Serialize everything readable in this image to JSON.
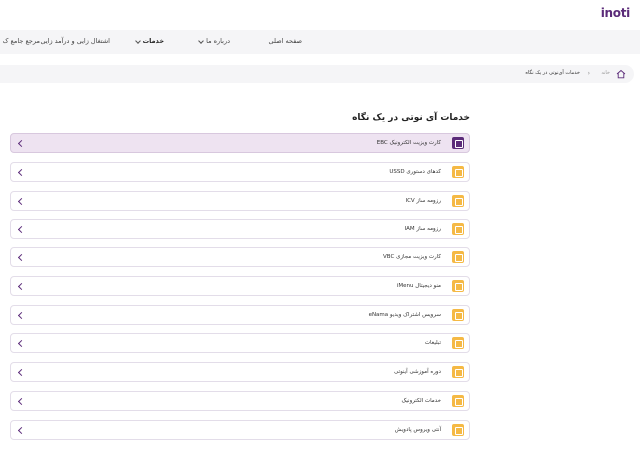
{
  "brand": {
    "logo_text": "inoti",
    "accent": "#5b2b79",
    "highlight": "#f5b945"
  },
  "nav": {
    "items": [
      {
        "label": "صفحه اصلی",
        "has_dropdown": false
      },
      {
        "label": "درباره ما",
        "has_dropdown": true
      },
      {
        "label": "خدمات",
        "has_dropdown": true
      },
      {
        "label": "اشتغال زایی و درآمد زایی",
        "has_dropdown": false
      },
      {
        "label": "مرجع جامع ک",
        "has_dropdown": false
      }
    ]
  },
  "breadcrumb": {
    "icon": "home-icon",
    "items": [
      "خانه",
      "خدمات آی‌نوتی در یک نگاه"
    ]
  },
  "page_title": "خدمات آی نوتی در یک نگاه",
  "services": [
    {
      "label": "کارت ویزیت الکترونیک EBC",
      "icon": "id-card-icon",
      "active": true
    },
    {
      "label": "کدهای دستوری USSD",
      "icon": "phone-icon",
      "active": false
    },
    {
      "label": "رزومه ساز ICV",
      "icon": "document-icon",
      "active": false
    },
    {
      "label": "رزومه ساز IAM",
      "icon": "profile-document-icon",
      "active": false
    },
    {
      "label": "کارت ویزیت مجازی VBC",
      "icon": "qr-code-icon",
      "active": false
    },
    {
      "label": "منو دیجیتال iMenu",
      "icon": "food-cloche-icon",
      "active": false
    },
    {
      "label": "سرویس اشتراک ویدیو eNama",
      "icon": "video-icon",
      "active": false
    },
    {
      "label": "تبلیغات",
      "icon": "megaphone-icon",
      "active": false
    },
    {
      "label": "دوره آموزشی آینوتی",
      "icon": "laptop-icon",
      "active": false
    },
    {
      "label": "خدمات الکترونیک",
      "icon": "tablet-icon",
      "active": false
    },
    {
      "label": "آنتی ویروس پادویش",
      "icon": "shield-icon",
      "active": false
    }
  ]
}
